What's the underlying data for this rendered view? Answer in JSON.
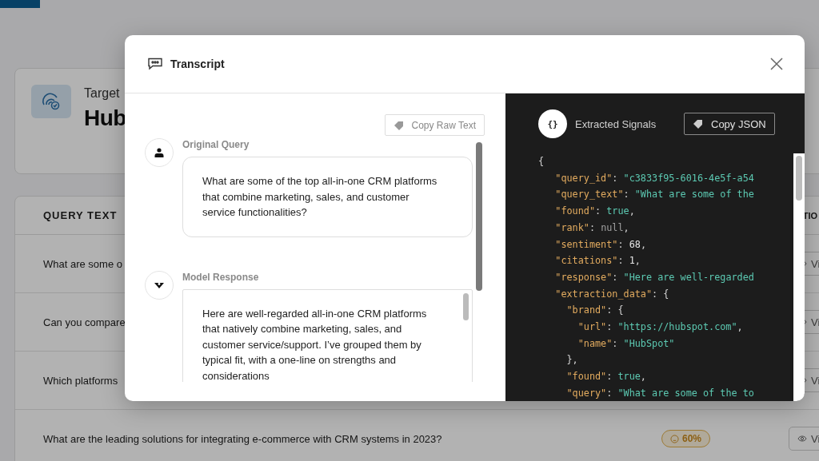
{
  "background": {
    "target_label": "Target",
    "brand_name": "Hub",
    "table": {
      "columns": [
        "QUERY TEXT",
        "TIO"
      ],
      "rows": [
        {
          "query": "What are some o",
          "view": "Vi"
        },
        {
          "query": "Can you compare",
          "view": "Vi"
        },
        {
          "query": "Which platforms",
          "view": "Vi"
        },
        {
          "query": "What are the leading solutions for integrating e-commerce with CRM systems in 2023?",
          "sentiment": "60%",
          "view": "Vi"
        }
      ]
    }
  },
  "modal": {
    "title": "Transcript",
    "copy_raw_label": "Copy Raw Text",
    "messages": [
      {
        "kind": "user",
        "label": "Original Query",
        "text": "What are some of the top all-in-one CRM platforms that combine marketing, sales, and customer service functionalities?"
      },
      {
        "kind": "model",
        "label": "Model Response",
        "text": "Here are well-regarded all-in-one CRM platforms that natively combine marketing, sales, and customer service/support. I’ve grouped them by typical fit, with a one-line on strengths and considerations"
      }
    ],
    "signals_icon": "{}",
    "signals_title": "Extracted Signals",
    "copy_json_label": "Copy JSON",
    "code_lines": [
      {
        "tokens": [
          {
            "kind": "punct",
            "text": "{"
          }
        ],
        "children": [
          {
            "tokens": [
              {
                "kind": "key",
                "text": "\"query_id\""
              },
              {
                "kind": "punct",
                "text": ": "
              },
              {
                "kind": "string",
                "text": "\"c3833f95-6016-4e5f-a54"
              }
            ]
          },
          {
            "tokens": [
              {
                "kind": "key",
                "text": "\"query_text\""
              },
              {
                "kind": "punct",
                "text": ": "
              },
              {
                "kind": "string",
                "text": "\"What are some of the"
              }
            ]
          },
          {
            "tokens": [
              {
                "kind": "key",
                "text": "\"found\""
              },
              {
                "kind": "punct",
                "text": ": "
              },
              {
                "kind": "literal",
                "text": "true"
              },
              {
                "kind": "punct",
                "text": ","
              }
            ]
          },
          {
            "tokens": [
              {
                "kind": "key",
                "text": "\"rank\""
              },
              {
                "kind": "punct",
                "text": ": "
              },
              {
                "kind": "null",
                "text": "null"
              },
              {
                "kind": "punct",
                "text": ","
              }
            ]
          },
          {
            "tokens": [
              {
                "kind": "key",
                "text": "\"sentiment\""
              },
              {
                "kind": "punct",
                "text": ": "
              },
              {
                "kind": "number",
                "text": "68"
              },
              {
                "kind": "punct",
                "text": ","
              }
            ]
          },
          {
            "tokens": [
              {
                "kind": "key",
                "text": "\"citations\""
              },
              {
                "kind": "punct",
                "text": ": "
              },
              {
                "kind": "number",
                "text": "1"
              },
              {
                "kind": "punct",
                "text": ","
              }
            ]
          },
          {
            "tokens": [
              {
                "kind": "key",
                "text": "\"response\""
              },
              {
                "kind": "punct",
                "text": ": "
              },
              {
                "kind": "string",
                "text": "\"Here are well-regarded"
              }
            ]
          },
          {
            "tokens": [
              {
                "kind": "key",
                "text": "\"extraction_data\""
              },
              {
                "kind": "punct",
                "text": ": {"
              }
            ],
            "children": [
              {
                "tokens": [
                  {
                    "kind": "key",
                    "text": "\"brand\""
                  },
                  {
                    "kind": "punct",
                    "text": ": {"
                  }
                ],
                "children": [
                  {
                    "tokens": [
                      {
                        "kind": "key",
                        "text": "\"url\""
                      },
                      {
                        "kind": "punct",
                        "text": ": "
                      },
                      {
                        "kind": "string",
                        "text": "\"https://hubspot.com\""
                      },
                      {
                        "kind": "punct",
                        "text": ","
                      }
                    ]
                  },
                  {
                    "tokens": [
                      {
                        "kind": "key",
                        "text": "\"name\""
                      },
                      {
                        "kind": "punct",
                        "text": ": "
                      },
                      {
                        "kind": "string",
                        "text": "\"HubSpot\""
                      }
                    ]
                  }
                ]
              },
              {
                "tokens": [
                  {
                    "kind": "punct",
                    "text": "},"
                  }
                ]
              },
              {
                "tokens": [
                  {
                    "kind": "key",
                    "text": "\"found\""
                  },
                  {
                    "kind": "punct",
                    "text": ": "
                  },
                  {
                    "kind": "literal",
                    "text": "true"
                  },
                  {
                    "kind": "punct",
                    "text": ","
                  }
                ]
              },
              {
                "tokens": [
                  {
                    "kind": "key",
                    "text": "\"query\""
                  },
                  {
                    "kind": "punct",
                    "text": ": "
                  },
                  {
                    "kind": "string",
                    "text": "\"What are some of the to"
                  }
                ]
              }
            ]
          }
        ]
      }
    ]
  }
}
